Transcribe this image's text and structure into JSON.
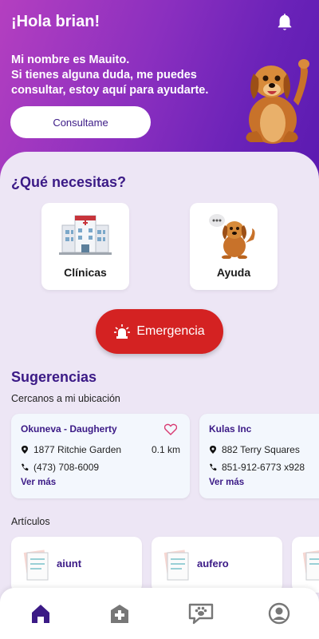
{
  "header": {
    "greeting": "¡Hola brian!",
    "intro_lines": [
      "Mi nombre es Mauito.",
      "Si tienes alguna duda, me puedes",
      "consultar, estoy aquí para ayudarte."
    ],
    "consult_button": "Consultame",
    "bell_icon": "bell-icon",
    "mascot_icon": "dog-mascot-icon"
  },
  "needs": {
    "title": "¿Qué necesitas?",
    "cards": [
      {
        "label": "Clínicas",
        "icon": "clinic-building-icon"
      },
      {
        "label": "Ayuda",
        "icon": "dog-chat-icon"
      }
    ],
    "emergency_button": "Emergencia",
    "emergency_icon": "siren-icon"
  },
  "suggestions": {
    "title": "Sugerencias",
    "nearby_label": "Cercanos a mi ubicación",
    "places": [
      {
        "name": "Okuneva - Daugherty",
        "address": "1877 Ritchie Garden",
        "phone": "(473) 708-6009",
        "distance": "0.1 km",
        "more": "Ver más",
        "favorite": false
      },
      {
        "name": "Kulas Inc",
        "address": "882 Terry Squares",
        "phone": "851-912-6773 x928",
        "more": "Ver más"
      }
    ]
  },
  "articles": {
    "title": "Artículos",
    "items": [
      {
        "label": "aiunt",
        "icon": "document-icon"
      },
      {
        "label": "aufero",
        "icon": "document-icon"
      },
      {
        "label": "",
        "icon": "document-icon"
      }
    ]
  },
  "navbar": {
    "items": [
      {
        "icon": "home-icon",
        "active": true
      },
      {
        "icon": "clinic-icon",
        "active": false
      },
      {
        "icon": "chat-paw-icon",
        "active": false
      },
      {
        "icon": "profile-icon",
        "active": false
      }
    ]
  },
  "colors": {
    "accent": "#3b1a86",
    "emergency": "#d42222",
    "header_gradient_start": "#b43fc0",
    "header_gradient_end": "#5a1ab0"
  }
}
